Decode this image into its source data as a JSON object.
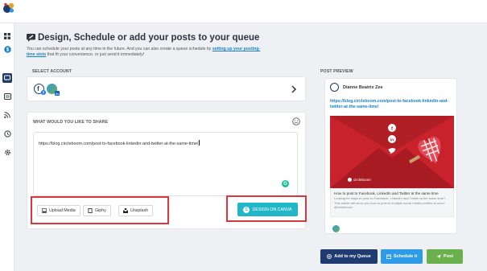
{
  "header": {
    "title": "Design, Schedule or add your posts to your queue",
    "subtitle_part1": "You can schedule your posts at any time in the future. And you can also create a queue schedule by ",
    "subtitle_link": "setting up your posting-time slots",
    "subtitle_part2": " that fit your convenience. or just send it immediately!"
  },
  "select_account": {
    "label": "SELECT ACCOUNT"
  },
  "composer": {
    "label": "WHAT WOULD YOU LIKE TO SHARE",
    "text": "https://blog.circleboom.com/post-to-facebook-linkedin-and-twitter-at-the-same-time/",
    "tools": [
      "Upload Media",
      "Giphy",
      "Unsplash"
    ],
    "canva_label": "DESIGN ON CANVA",
    "grammarly": "G"
  },
  "preview": {
    "label": "POST PREVIEW",
    "account_name": "Dianne Beatrix Zee",
    "link": "https://blog.circleboom.com/post-to-facebook-linkedin-and-twitter-at-the-same-time/",
    "caption_title": "How to post to Facebook, LinkedIn and Twitter at the same time",
    "caption_desc": "Looking for ways to post on Facebook, LinkedIn and Twitter at the same time? This article will show you how to post to multiple social media profiles at once!",
    "caption_handle": "@circleboom",
    "image_brand": "circleboom"
  },
  "actions": {
    "add_queue": "Add to my Queue",
    "schedule": "Schedule it",
    "post": "Post"
  },
  "colors": {
    "navy": "#1f3b6f",
    "cyan": "#21b7c9",
    "blue": "#2f9ae6",
    "green": "#6ab04c",
    "highlight_red": "#d9363e",
    "link": "#1a82c9"
  }
}
